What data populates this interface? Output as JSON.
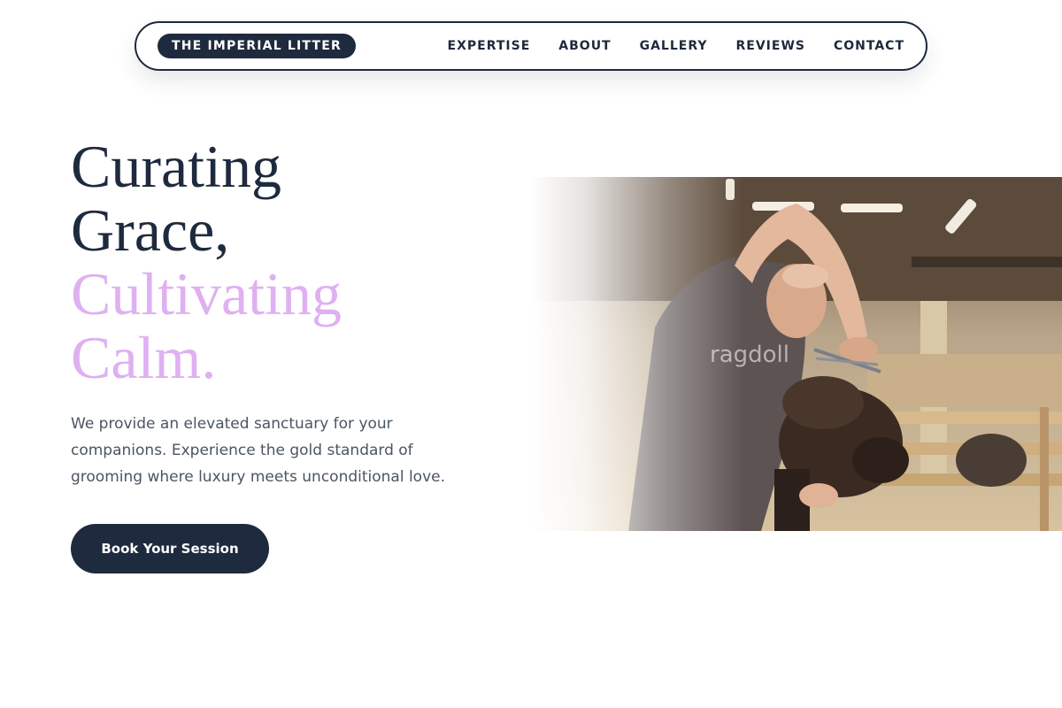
{
  "nav": {
    "brand": "THE IMPERIAL LITTER",
    "links": [
      "EXPERTISE",
      "ABOUT",
      "GALLERY",
      "REVIEWS",
      "CONTACT"
    ]
  },
  "hero": {
    "title_line1": "Curating",
    "title_line2": "Grace,",
    "accent_line1": "Cultivating",
    "accent_line2": "Calm.",
    "description": "We provide an elevated sanctuary for your companions. Experience the gold standard of grooming where luxury meets unconditional love.",
    "cta_label": "Book Your Session"
  },
  "image": {
    "watermark": "ragdoll"
  },
  "colors": {
    "primary": "#1e2a3d",
    "accent": "#dfb0f2",
    "body_text": "#4b5563"
  }
}
